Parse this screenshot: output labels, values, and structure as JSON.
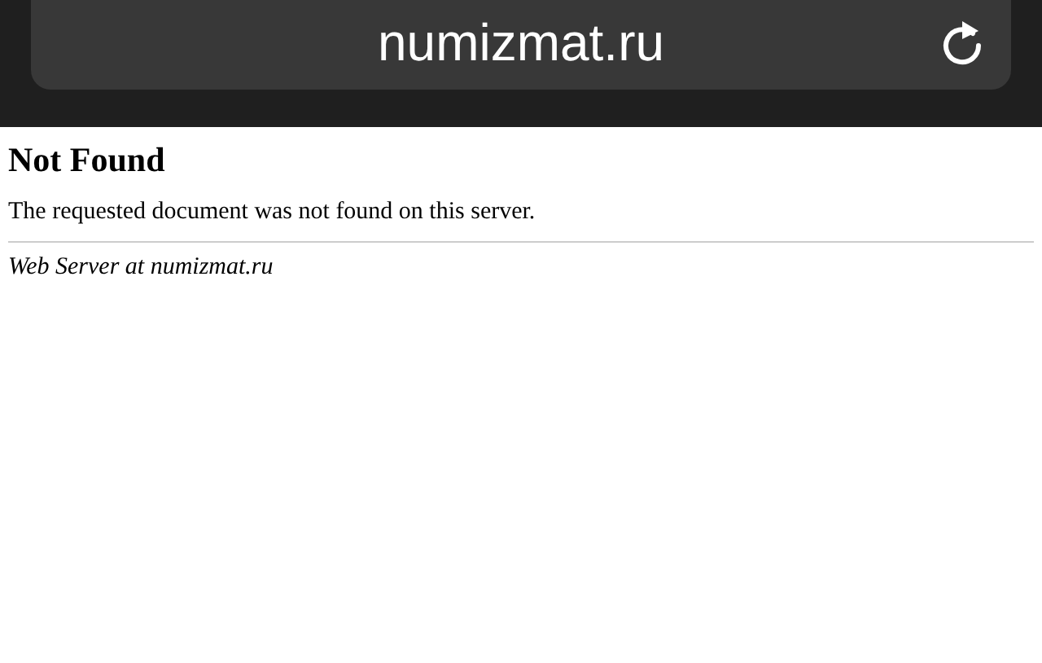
{
  "address_bar": {
    "url": "numizmat.ru"
  },
  "page": {
    "heading": "Not Found",
    "message": "The requested document was not found on this server.",
    "footer": "Web Server at numizmat.ru"
  }
}
